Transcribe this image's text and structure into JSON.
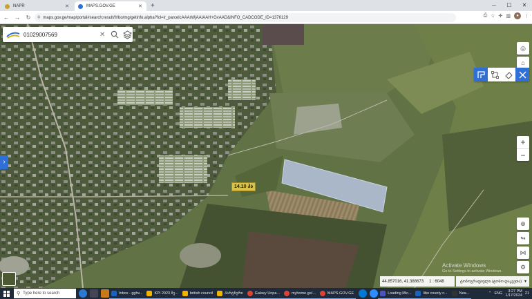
{
  "browser": {
    "tabs": [
      {
        "title": "NAPR",
        "active": false
      },
      {
        "title": "MAPS.GOV.GE",
        "active": true
      }
    ],
    "new_tab_symbol": "+",
    "url": "maps.gov.ge/map/portal#search;result/fr/bo/mg/getinfo.alpha?fcl=ir_parcelcAAArWjAAIAAH+GvAAD&INFO_CADCODE_ID=1376129"
  },
  "map": {
    "search_value": "01029007569",
    "parcel_label": "14.10 ჰა",
    "coordinates": {
      "lat_lon": "44.857016, 41.388673",
      "scale": "1 : 6048"
    },
    "layer_select": "ტოპოგრაფიული (ტოპო დაკვეთა)",
    "watermark": {
      "title": "Activate Windows",
      "subtitle": "Go to Settings to activate Windows."
    },
    "colors": {
      "accent": "#2f6fd6",
      "parcel_label_bg": "#d9c24a"
    }
  },
  "taskbar": {
    "search_placeholder": "Type here to search",
    "apps": [
      {
        "label": "Inbox - gghv...",
        "color": "#1565c0"
      },
      {
        "label": "KPI 2023 შე...",
        "color": "#f0b400"
      },
      {
        "label": "british council",
        "color": "#f0b400"
      },
      {
        "label": "პარტნერი",
        "color": "#f0b400"
      },
      {
        "label": "Galaxy Unpa...",
        "color": "#db4437"
      },
      {
        "label": "myhome.ge/...",
        "color": "#db4437"
      },
      {
        "label": "MAPS.GOV.GE",
        "color": "#db4437"
      },
      {
        "label": "Loading Mic...",
        "color": "#4b53bc"
      },
      {
        "label": "libo county c...",
        "color": "#1565c0"
      },
      {
        "label": "Nea...",
        "color": "#333333"
      }
    ],
    "tray": {
      "lang": "ENG",
      "time": "3:27 PM",
      "date": "1/17/2024",
      "notifications": "21"
    }
  }
}
